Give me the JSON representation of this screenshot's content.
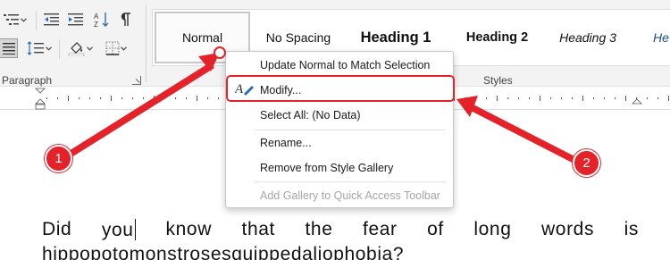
{
  "ribbon": {
    "paragraph_group_label": "Paragraph",
    "styles_group_label": "Styles",
    "icons": [
      "multilevel-list-icon",
      "decrease-indent-icon",
      "increase-indent-icon",
      "sort-icon",
      "show-formatting-marks-icon",
      "justify-icon",
      "line-spacing-icon",
      "shading-icon",
      "borders-icon",
      "dialog-launcher-icon"
    ]
  },
  "styles": [
    "Normal",
    "No Spacing",
    "Heading 1",
    "Heading 2",
    "Heading 3",
    "He"
  ],
  "context_menu": {
    "items": [
      {
        "label": "Update Normal to Match Selection",
        "disabled": false
      },
      {
        "label": "Modify...",
        "disabled": false
      },
      {
        "label": "Select All: (No Data)",
        "disabled": false
      },
      {
        "label": "Rename...",
        "disabled": false
      },
      {
        "label": "Remove from Style Gallery",
        "disabled": false
      },
      {
        "label": "Add Gallery to Quick Access Toolbar",
        "disabled": true
      }
    ]
  },
  "document": {
    "line1_words": [
      "Did",
      "you",
      "know",
      "that",
      "the",
      "fear",
      "of",
      "long",
      "words",
      "is"
    ],
    "line2": "hippopotomonstrosesquippedaliophobia?"
  },
  "callouts": {
    "one": "1",
    "two": "2"
  },
  "colors": {
    "accent_red": "#e3222a",
    "ribbon_bg": "#f3f3f3",
    "heading_blue": "#1f4e79"
  }
}
